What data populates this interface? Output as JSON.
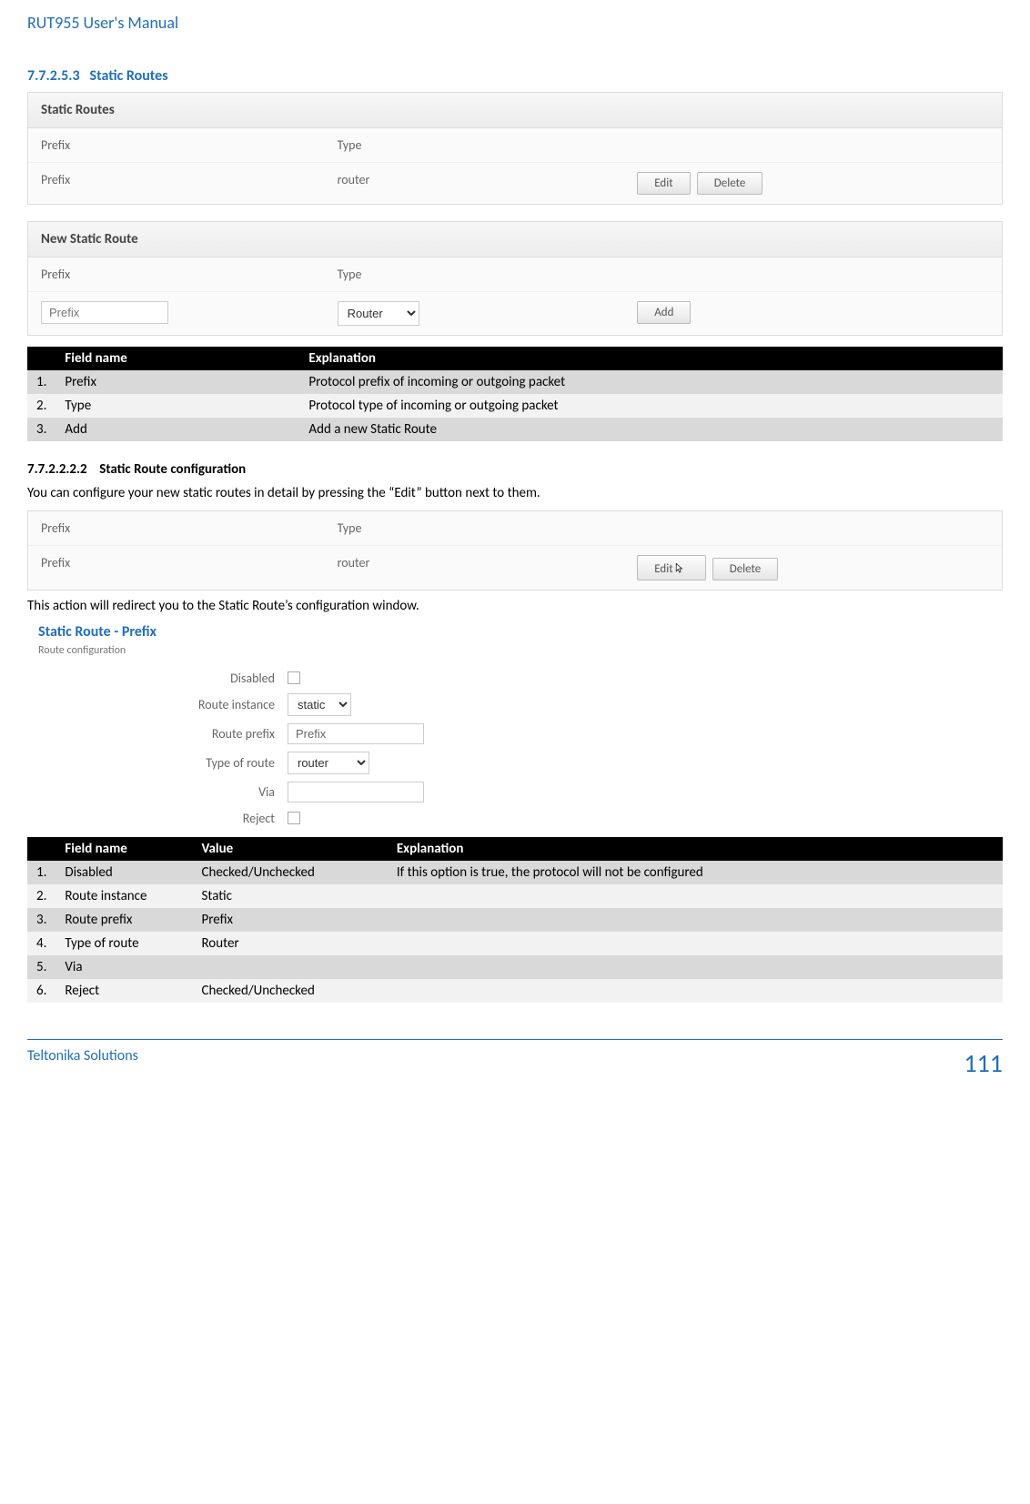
{
  "header": {
    "title": "RUT955 User's Manual"
  },
  "section1": {
    "number": "7.7.2.5.3",
    "title": "Static Routes"
  },
  "staticRoutesPanel": {
    "title": "Static Routes",
    "col1": "Prefix",
    "col2": "Type",
    "row1_c1": "Prefix",
    "row1_c2": "router",
    "editBtn": "Edit",
    "deleteBtn": "Delete"
  },
  "newRoutePanel": {
    "title": "New Static Route",
    "col1": "Prefix",
    "col2": "Type",
    "inputPlaceholder": "Prefix",
    "selectValue": "Router",
    "addBtn": "Add"
  },
  "table1": {
    "h_field": "Field name",
    "h_expl": "Explanation",
    "rows": [
      {
        "n": "1.",
        "f": "Prefix",
        "e": "Protocol prefix of incoming or outgoing packet"
      },
      {
        "n": "2.",
        "f": "Type",
        "e": "Protocol type of incoming or outgoing packet"
      },
      {
        "n": "3.",
        "f": "Add",
        "e": "Add a new Static Route"
      }
    ]
  },
  "section2": {
    "number": "7.7.2.2.2.2",
    "title": "Static Route configuration",
    "para1": "You can configure your new static routes in detail by pressing the “Edit” button next to them.",
    "para2": "This action will redirect you to the Static Route’s configuration window."
  },
  "editRow": {
    "col1": "Prefix",
    "col2": "Type",
    "r1": "Prefix",
    "r2": "router",
    "editBtn": "Edit",
    "deleteBtn": "Delete"
  },
  "configForm": {
    "title": "Static Route - Prefix",
    "sub": "Route configuration",
    "fields": {
      "disabled": "Disabled",
      "instance": "Route instance",
      "instanceVal": "static",
      "prefix": "Route prefix",
      "prefixVal": "Prefix",
      "type": "Type of route",
      "typeVal": "router",
      "via": "Via",
      "reject": "Reject"
    }
  },
  "table2": {
    "h_field": "Field name",
    "h_val": "Value",
    "h_expl": "Explanation",
    "rows": [
      {
        "n": "1.",
        "f": "Disabled",
        "v": "Checked/Unchecked",
        "e": "If this option is true, the protocol will not be configured"
      },
      {
        "n": "2.",
        "f": "Route instance",
        "v": "Static",
        "e": ""
      },
      {
        "n": "3.",
        "f": "Route prefix",
        "v": "Prefix",
        "e": ""
      },
      {
        "n": "4.",
        "f": "Type of route",
        "v": "Router",
        "e": ""
      },
      {
        "n": "5.",
        "f": "Via",
        "v": "",
        "e": ""
      },
      {
        "n": "6.",
        "f": "Reject",
        "v": "Checked/Unchecked",
        "e": ""
      }
    ]
  },
  "footer": {
    "left": "Teltonika Solutions",
    "page": "111"
  }
}
